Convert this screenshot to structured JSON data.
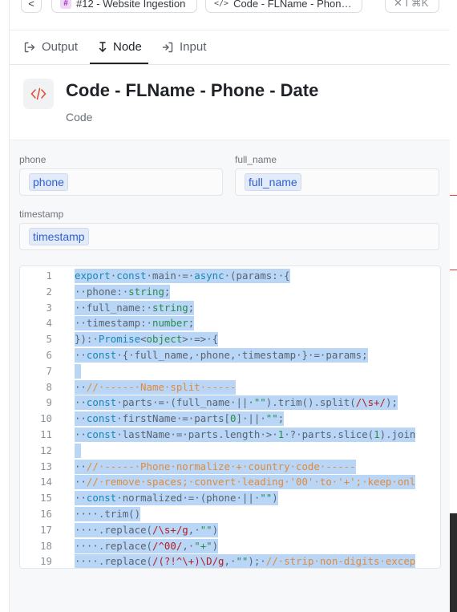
{
  "breadcrumb": {
    "back_label": "<",
    "workflow_label": "#12 - Website Ingestion",
    "node_label": "Code - FLName - Phon…",
    "close_label": "✕ I ⌘K"
  },
  "tabs": [
    {
      "label": "Output",
      "icon": "log-out-icon",
      "active": false
    },
    {
      "label": "Node",
      "icon": "node-arrow-icon",
      "active": true
    },
    {
      "label": "Input",
      "icon": "log-in-icon",
      "active": false
    }
  ],
  "node": {
    "title": "Code - FLName - Phone - Date",
    "type": "Code",
    "icon": "code-icon",
    "accent": "#e0492f"
  },
  "fields": [
    {
      "label": "phone",
      "value": "phone"
    },
    {
      "label": "full_name",
      "value": "full_name"
    },
    {
      "label": "timestamp",
      "value": "timestamp"
    }
  ],
  "code": {
    "lines": [
      {
        "n": "1",
        "text": "export·const·main·=·async·(params:·{"
      },
      {
        "n": "2",
        "text": "··phone:·string;"
      },
      {
        "n": "3",
        "text": "··full_name:·string;"
      },
      {
        "n": "4",
        "text": "··timestamp:·number;"
      },
      {
        "n": "5",
        "text": "}):·Promise<object>·=>·{"
      },
      {
        "n": "6",
        "text": "··const·{·full_name,·phone,·timestamp·}·=·params;"
      },
      {
        "n": "7",
        "text": ""
      },
      {
        "n": "8",
        "text": "··//·-----·Name·split·-----"
      },
      {
        "n": "9",
        "text": "··const·parts·=·(full_name·||·\"\").trim().split(/\\s+/);"
      },
      {
        "n": "10",
        "text": "··const·firstName·=·parts[0]·||·\"\";"
      },
      {
        "n": "11",
        "text": "··const·lastName·=·parts.length·>·1·?·parts.slice(1).join"
      },
      {
        "n": "12",
        "text": ""
      },
      {
        "n": "13",
        "text": "··//·-----·Phone·normalize·+·country·code·-----"
      },
      {
        "n": "14",
        "text": "··//·remove·spaces;·convert·leading·'00'·to·'+';·keep·onl"
      },
      {
        "n": "15",
        "text": "··const·normalized·=·(phone·||·\"\")"
      },
      {
        "n": "16",
        "text": "····.trim()"
      },
      {
        "n": "17",
        "text": "····.replace(/\\s+/g,·\"\")"
      },
      {
        "n": "18",
        "text": "····.replace(/^00/,·\"+\")"
      },
      {
        "n": "19",
        "text": "····.replace(/(?!^\\+)\\D/g,·\"\");·//·strip·non-digits·excep"
      }
    ]
  },
  "colors": {
    "selection": "#b9d6f7",
    "keyword": "#1b86b1",
    "type": "#2a8a4a",
    "comment": "#e08a3c",
    "regex": "#b32020"
  }
}
